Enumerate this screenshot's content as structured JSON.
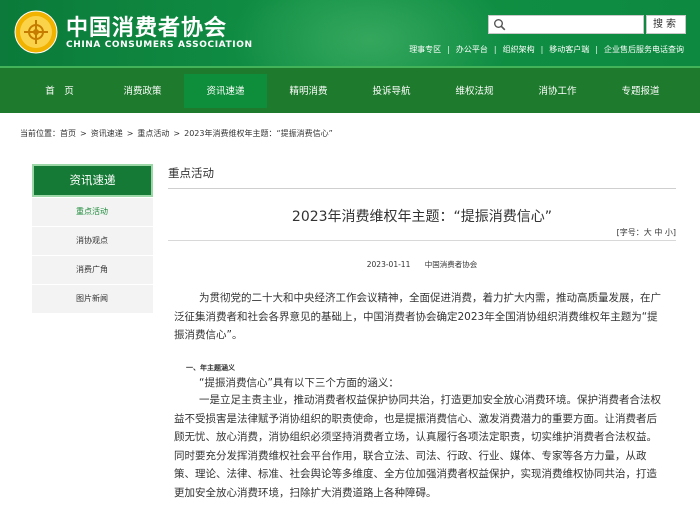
{
  "header": {
    "brand_cn": "中国消费者协会",
    "brand_en": "CHINA CONSUMERS ASSOCIATION",
    "search_placeholder": "",
    "search_button": "搜索",
    "top_links": [
      "理事专区",
      "办公平台",
      "组织架构",
      "移动客户端",
      "企业售后服务电话查询"
    ]
  },
  "nav": {
    "items": [
      "首　页",
      "消费政策",
      "资讯速递",
      "精明消费",
      "投诉导航",
      "维权法规",
      "消协工作",
      "专题报道"
    ],
    "active_index": 2
  },
  "breadcrumb": {
    "prefix": "当前位置：",
    "items": [
      "首页",
      "资讯速递",
      "重点活动",
      "2023年消费维权年主题：“提振消费信心”"
    ]
  },
  "sidebar": {
    "title": "资讯速递",
    "items": [
      "重点活动",
      "消协观点",
      "消费广角",
      "图片新闻"
    ],
    "active_index": 0
  },
  "main": {
    "section_title": "重点活动",
    "article_title": "2023年消费维权年主题：“提振消费信心”",
    "font_size_control": "[字号：大 中 小]",
    "date": "2023-01-11",
    "source": "中国消费者协会",
    "paragraph1": "为贯彻党的二十大和中央经济工作会议精神，全面促进消费，着力扩大内需，推动高质量发展，在广泛征集消费者和社会各界意见的基础上，中国消费者协会确定2023年全国消协组织消费维权年主题为“提振消费信心”。",
    "subheading": "一、年主题涵义",
    "paragraph2": "“提振消费信心”具有以下三个方面的涵义：",
    "paragraph3": "一是立足主责主业，推动消费者权益保护协同共治，打造更加安全放心消费环境。保护消费者合法权益不受损害是法律赋予消协组织的职责使命，也是提振消费信心、激发消费潜力的重要方面。让消费者后顾无忧、放心消费，消协组织必须坚持消费者立场，认真履行各项法定职责，切实维护消费者合法权益。同时要充分发挥消费维权社会平台作用，联合立法、司法、行政、行业、媒体、专家等各方力量，从政策、理论、法律、标准、社会舆论等多维度、全方位加强消费者权益保护，实现消费维权协同共治，打造更加安全放心消费环境，扫除扩大消费道路上各种障碍。"
  },
  "colors": {
    "header_green": "#119145",
    "nav_green": "#1e7a2c",
    "nav_active": "#0e8d3a",
    "sidebar_head": "#157a35",
    "accent_text": "#1c8a3a"
  }
}
